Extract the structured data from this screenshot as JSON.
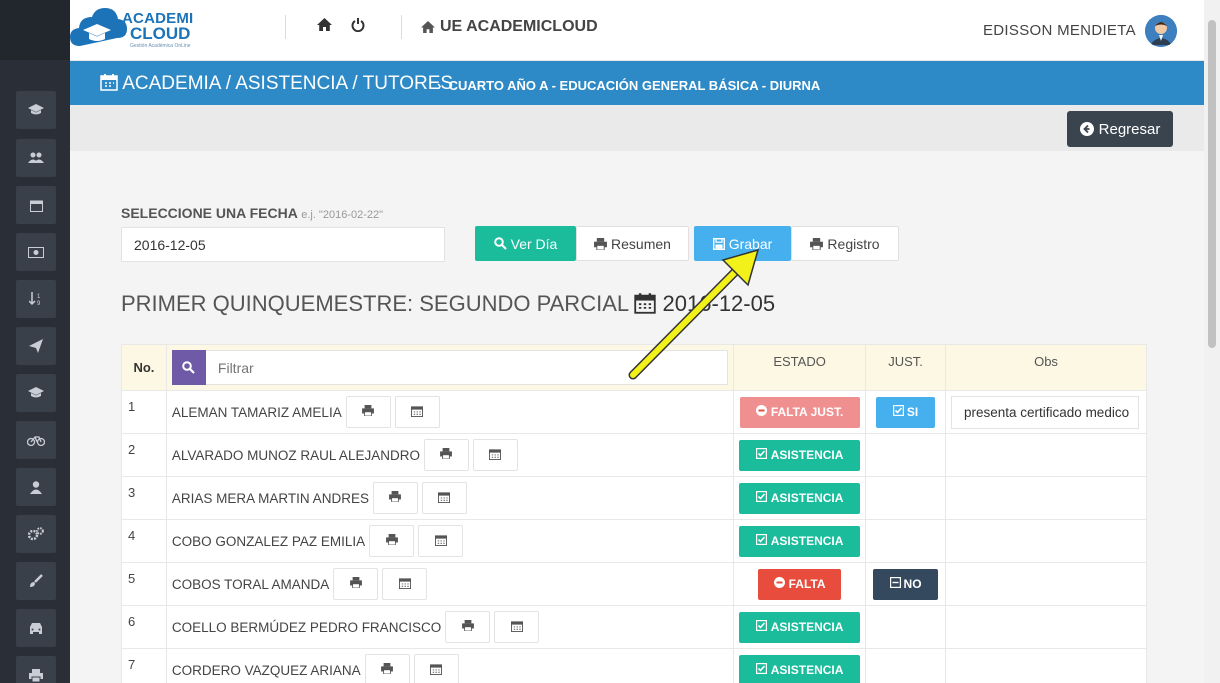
{
  "header": {
    "logo_line1": "ACADEMI",
    "logo_line2": "CLOUD",
    "logo_sub": "Gestión Académica OnLine",
    "brand": "UE ACADEMICLOUD",
    "user_name": "EDISSON MENDIETA"
  },
  "banner": {
    "breadcrumb": "ACADEMIA / ASISTENCIA / TUTORES",
    "subtitle": "CUARTO AÑO A - EDUCACIÓN GENERAL BÁSICA - DIURNA"
  },
  "back_button": {
    "label": "Regresar"
  },
  "date_form": {
    "label": "SELECCIONE UNA FECHA",
    "hint": "e.j. \"2016-02-22\"",
    "value": "2016-12-05"
  },
  "actions": {
    "ver_dia": "Ver Día",
    "resumen": "Resumen",
    "grabar": "Grabar",
    "registro": "Registro"
  },
  "section": {
    "title": "PRIMER QUINQUEMESTRE: SEGUNDO PARCIAL",
    "date": "2016-12-05"
  },
  "table": {
    "headers": {
      "no": "No.",
      "filter_placeholder": "Filtrar",
      "estado": "ESTADO",
      "just": "JUST.",
      "obs": "Obs"
    },
    "rows": [
      {
        "no": "1",
        "name": "ALEMAN TAMARIZ AMELIA",
        "estado": "FALTA JUST.",
        "estado_type": "faltajust",
        "just": "SI",
        "obs": "presenta certificado medico"
      },
      {
        "no": "2",
        "name": "ALVARADO MUNOZ RAUL ALEJANDRO",
        "estado": "ASISTENCIA",
        "estado_type": "asist",
        "just": "",
        "obs": ""
      },
      {
        "no": "3",
        "name": "ARIAS MERA MARTIN ANDRES",
        "estado": "ASISTENCIA",
        "estado_type": "asist",
        "just": "",
        "obs": ""
      },
      {
        "no": "4",
        "name": "COBO GONZALEZ PAZ EMILIA",
        "estado": "ASISTENCIA",
        "estado_type": "asist",
        "just": "",
        "obs": ""
      },
      {
        "no": "5",
        "name": "COBOS TORAL AMANDA",
        "estado": "FALTA",
        "estado_type": "falta",
        "just": "NO",
        "obs": ""
      },
      {
        "no": "6",
        "name": "COELLO BERMÚDEZ PEDRO FRANCISCO",
        "estado": "ASISTENCIA",
        "estado_type": "asist",
        "just": "",
        "obs": ""
      },
      {
        "no": "7",
        "name": "CORDERO VAZQUEZ ARIANA",
        "estado": "ASISTENCIA",
        "estado_type": "asist",
        "just": "",
        "obs": ""
      }
    ]
  },
  "sidebar": {
    "icons": [
      "graduation-cap-icon",
      "users-icon",
      "calendar-icon",
      "money-icon",
      "sort-icon",
      "paper-plane-icon",
      "graduation-cap-icon",
      "bicycle-icon",
      "user-icon",
      "cogs-icon",
      "brush-icon",
      "car-icon",
      "print-icon"
    ]
  },
  "colors": {
    "sidebar": "#2a2f37",
    "banner": "#2d8ac7",
    "teal": "#1abc9c",
    "blue": "#46b0ef",
    "red": "#e74c3c",
    "pink": "#f08f8f",
    "dark": "#34495e",
    "purple": "#6f5aa8",
    "arrow": "#f2f21a"
  }
}
